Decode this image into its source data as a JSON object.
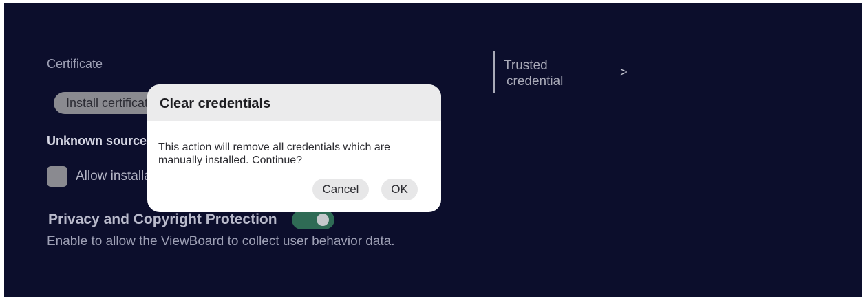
{
  "settings": {
    "certificate_label": "Certificate",
    "install_button_label": "Install certificate",
    "unknown_sources_label": "Unknown sources",
    "allow_install_label": "Allow installation of apps from unknown sources",
    "privacy_label": "Privacy and Copyright Protection",
    "privacy_description": "Enable to allow the ViewBoard to collect user behavior data.",
    "privacy_toggle_on": true
  },
  "right_panel": {
    "trusted_line1": "Trusted",
    "trusted_line2": "credential",
    "chevron": ">"
  },
  "dialog": {
    "title": "Clear credentials",
    "message": "This action will remove all credentials which are manually installed. Continue?",
    "cancel_label": "Cancel",
    "ok_label": "OK"
  },
  "colors": {
    "background": "#0c0e2c",
    "toggle_on": "#2f6b55",
    "dialog_bg": "#ffffff",
    "dialog_header": "#ebebec"
  }
}
